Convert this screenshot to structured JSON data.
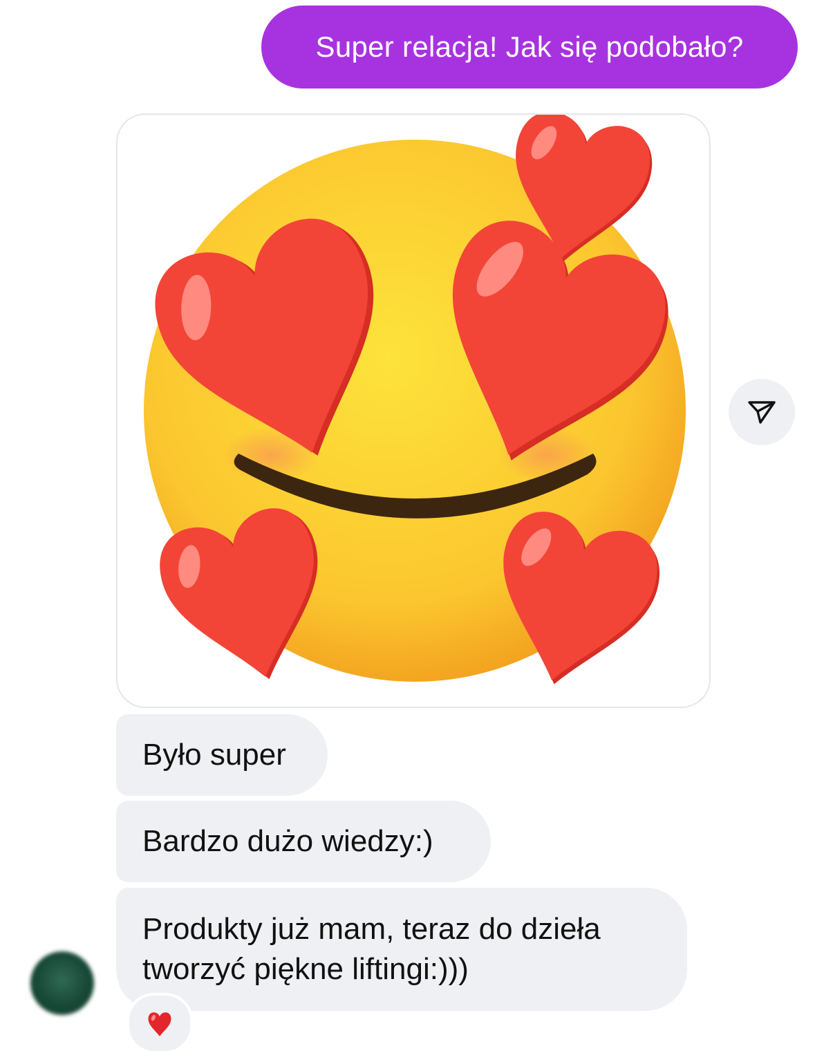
{
  "messages": {
    "sent": [
      {
        "text": "Super relacja! Jak się podobało?"
      }
    ],
    "received": [
      {
        "text": "Było super"
      },
      {
        "text": "Bardzo dużo wiedzy:)"
      },
      {
        "text_line1": "Produkty już mam, teraz do dzieła",
        "text_line2": "tworzyć piękne liftingi:)))"
      }
    ]
  },
  "sticker": {
    "icon": "smiling-face-with-heart-eyes-icon"
  },
  "actions": {
    "share_icon": "paper-plane-icon"
  },
  "reaction": {
    "icon": "red-heart-icon"
  },
  "colors": {
    "sent_bubble": "#a733e0",
    "received_bubble": "#eef0f3",
    "heart": "#f24537",
    "face": "#fcd93f"
  }
}
